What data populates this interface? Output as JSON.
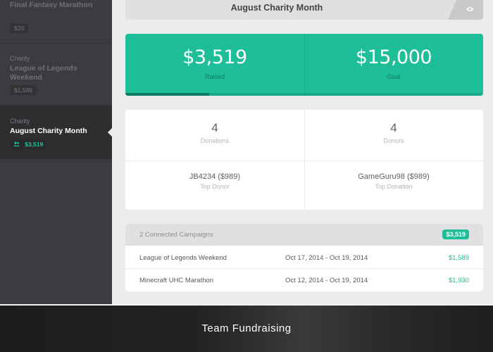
{
  "sidebar": {
    "campaigns": [
      {
        "category": "",
        "name": "Final Fantasy Marathon",
        "amount": "$20"
      },
      {
        "category": "Charity",
        "name": "League of Legends Weekend",
        "amount": "$1,589"
      },
      {
        "category": "Charity",
        "name": "August Charity Month",
        "amount": "$3,519",
        "icon": "people-icon",
        "active": true
      }
    ]
  },
  "header": {
    "title": "August Charity Month",
    "icon": "eye-icon"
  },
  "progress": {
    "raised_value": "$3,519",
    "raised_label": "Raised",
    "goal_value": "$15,000",
    "goal_label": "Goal",
    "fraction": 0.2346
  },
  "stats": {
    "donations_value": "4",
    "donations_label": "Donations",
    "donors_value": "4",
    "donors_label": "Donors",
    "top_donor_value": "JB4234 ($989)",
    "top_donor_label": "Top Donor",
    "top_donation_value": "GameGuru98 ($989)",
    "top_donation_label": "Top Donation"
  },
  "connected": {
    "header": "2 Connected Campaigns",
    "total": "$3,519",
    "rows": [
      {
        "name": "League of Legends Weekend",
        "dates": "Oct 17, 2014 - Oct 19, 2014",
        "amount": "$1,589"
      },
      {
        "name": "Minecraft UHC Marathon",
        "dates": "Oct 12, 2014 - Oct 19, 2014",
        "amount": "$1,930"
      }
    ]
  },
  "caption": "Team Fundraising",
  "colors": {
    "accent": "#1ebe98",
    "sidebar": "#3c3c40",
    "sidebar_active": "#2e2e31"
  }
}
